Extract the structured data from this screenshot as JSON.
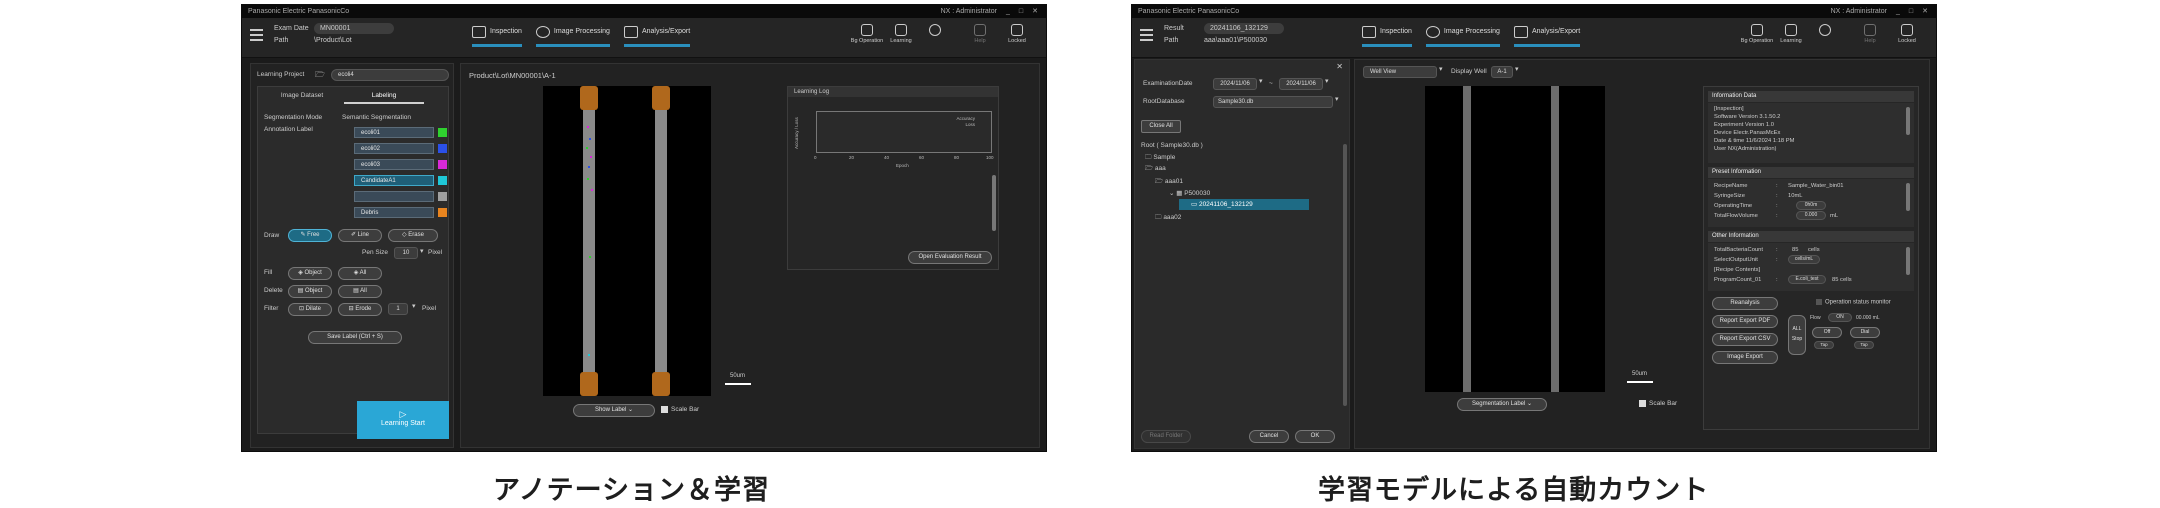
{
  "left_screen": {
    "window_title": "Panasonic Electric PanasonicCo",
    "window_user": "NX : Administrator",
    "window_controls": [
      "_",
      "□",
      "✕"
    ],
    "exam_date_label": "Exam Date",
    "exam_date_value": "MN00001",
    "path_label": "Path",
    "path_value": "\\Product\\Lot",
    "steps": [
      "Inspection",
      "Image Processing",
      "Analysis/Export"
    ],
    "top_buttons": [
      "Bg Operation",
      "Learning",
      "Setting",
      "Help",
      "Locked"
    ],
    "learning_project_label": "Learning Project",
    "learning_project_value": "ecoli4",
    "tabs": [
      "Image Dataset",
      "Labeling"
    ],
    "segmentation_mode_label": "Segmentation Mode",
    "segmentation_mode_value": "Semantic Segmentation",
    "annotation_label": "Annotation Label",
    "annotations": [
      {
        "name": "ecoli01",
        "color": "#2fd12f"
      },
      {
        "name": "ecoli02",
        "color": "#2b50e8"
      },
      {
        "name": "ecoli03",
        "color": "#d929d9"
      },
      {
        "name": "CandidateA1",
        "color": "#1fc8d8"
      },
      {
        "name": "",
        "color": "#a0a0a0"
      },
      {
        "name": "Debris",
        "color": "#e8841f"
      }
    ],
    "draw_label": "Draw",
    "draw_buttons": [
      "Free",
      "Line",
      "Erase"
    ],
    "pen_size_label": "Pen Size",
    "pen_size_value": "10",
    "pen_unit": "Pixel",
    "fill_label": "Fill",
    "fill_buttons": [
      "Object",
      "All"
    ],
    "delete_label": "Delete",
    "delete_buttons": [
      "Object",
      "All"
    ],
    "filter_label": "Filter",
    "filter_buttons": [
      "Dilate",
      "Erode"
    ],
    "filter_value": "1",
    "filter_unit": "Pixel",
    "save_label": "Save Label (Ctrl + S)",
    "learning_start": "Learning Start",
    "image_title": "Product\\Lot\\MN00001\\A-1",
    "scale_label": "50um",
    "show_label": "Show Label",
    "scale_bar_label": "Scale Bar",
    "learning_log_title": "Learning Log",
    "legend": [
      "Accuracy",
      "Loss"
    ],
    "x_ticks": [
      "0",
      "20",
      "40",
      "60",
      "80",
      "100"
    ],
    "x_axis_label": "Epoch",
    "y_axis_label": "Accuracy / Loss",
    "open_eval": "Open Evaluation Result",
    "caption": "アノテーション＆学習"
  },
  "right_screen": {
    "window_title": "Panasonic Electric PanasonicCo",
    "window_user": "NX : Administrator",
    "window_controls": [
      "_",
      "□",
      "✕"
    ],
    "result_label": "Result",
    "result_value": "20241106_132129",
    "path_label": "Path",
    "path_value": "aaa\\aaa01\\P500030",
    "steps": [
      "Inspection",
      "Image Processing",
      "Analysis/Export"
    ],
    "top_buttons": [
      "Bg Operation",
      "Learning",
      "Setting",
      "Help",
      "Locked"
    ],
    "exam_date_label": "ExaminationDate",
    "date_from": "2024/11/06",
    "date_sep": "~",
    "date_to": "2024/11/06",
    "root_db_label": "RootDatabase",
    "root_db_value": "Sample30.db",
    "close_all": "Close All",
    "tree": [
      "Root ( Sample30.db )",
      "Sample",
      "aaa",
      "aaa01",
      "P500030",
      "20241106_132129",
      "aaa02"
    ],
    "footer_buttons": [
      "Read Folder",
      "Cancel",
      "OK"
    ],
    "view_select": "Well View",
    "display_well_label": "Display Well",
    "display_well_value": "A-1",
    "scale_label": "50um",
    "seg_label": "Segmentation Label",
    "scale_bar_label": "Scale Bar",
    "info_header": "Information Data",
    "info_lines": [
      "[Inspection]",
      "Software Version 3.1.50.2",
      "Experiment Version 1.0",
      "Device Electr.PanasMcEx",
      "Date & time 11/6/2024 1:18 PM",
      "User NX(Administration)"
    ],
    "preset_header": "Preset Information",
    "preset_rows": [
      {
        "k": "RecipeName",
        "v": "Sample_Water_bin01"
      },
      {
        "k": "SyringeSize",
        "v": "10mL"
      },
      {
        "k": "OperatingTime",
        "v": "0h0m"
      },
      {
        "k": "TotalFlowVolume",
        "v": "0.000",
        "u": "mL"
      }
    ],
    "other_header": "Other Information",
    "other_rows": [
      {
        "k": "TotalBacteriaCount",
        "v": "85",
        "u": "cells"
      },
      {
        "k": "SelectOutputUnit",
        "v": "cells/mL"
      },
      {
        "k": "[Recipe Contents]",
        "v": ""
      },
      {
        "k": "ProgramCount_01",
        "v": "E.coli_test",
        "u": "85 cells"
      }
    ],
    "reanalysis": "Reanalysis",
    "operation_monitor": "Operation status monitor",
    "export_buttons": [
      "Report Export   PDF",
      "Report Export   CSV",
      "Image Export"
    ],
    "all_stop": "ALL Stop",
    "flow_label": "Flow",
    "on_label": "ON",
    "flow_value": "00.000 mL",
    "off_label": "Off",
    "dial_labels": [
      "Off",
      "Dial"
    ],
    "tap_labels": [
      "Tap",
      "Tap"
    ],
    "caption": "学習モデルによる自動カウント"
  }
}
